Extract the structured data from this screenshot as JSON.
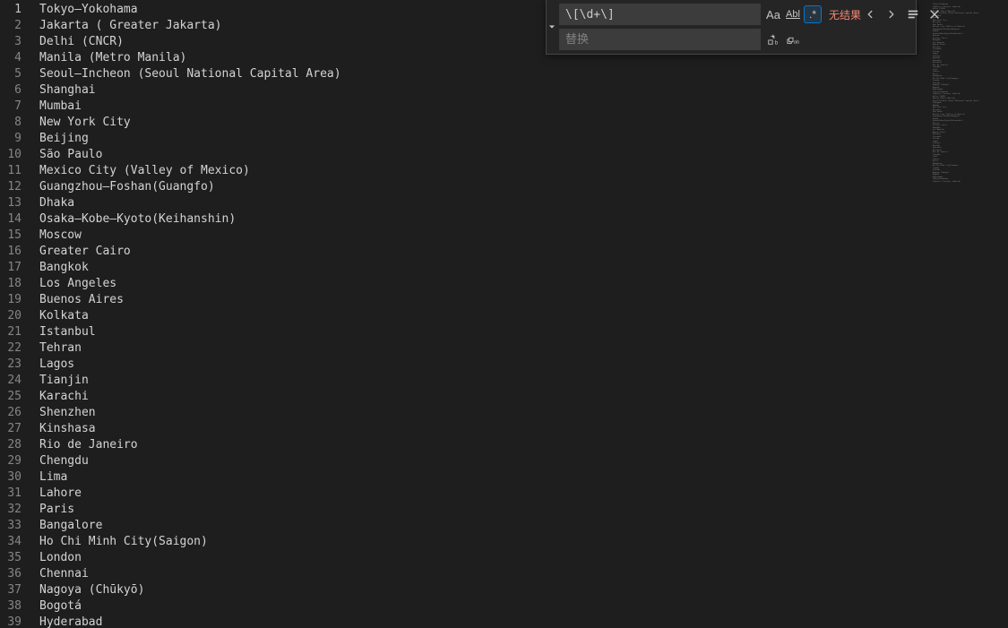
{
  "lines": [
    "Tokyo—Yokohama",
    "Jakarta ( Greater Jakarta)",
    "Delhi (CNCR)",
    "Manila (Metro Manila)",
    "Seoul—Incheon (Seoul National Capital Area)",
    "Shanghai",
    "Mumbai",
    "New York City",
    "Beijing",
    "São Paulo",
    "Mexico City (Valley of Mexico)",
    "Guangzhou—Foshan(Guangfo)",
    "Dhaka",
    "Osaka—Kobe—Kyoto(Keihanshin)",
    "Moscow",
    "Greater Cairo",
    "Bangkok",
    "Los Angeles",
    "Buenos Aires",
    "Kolkata",
    "Istanbul",
    "Tehran",
    "Lagos",
    "Tianjin",
    "Karachi",
    "Shenzhen",
    "Kinshasa",
    "Rio de Janeiro",
    "Chengdu",
    "Lima",
    "Lahore",
    "Paris",
    "Bangalore",
    "Ho Chi Minh City(Saigon)",
    "London",
    "Chennai",
    "Nagoya (Chūkyō)",
    "Bogotá",
    "Hyderabad"
  ],
  "activeLine": 1,
  "findReplace": {
    "searchValue": "\\[\\d+\\]",
    "replacePlaceholder": "替换",
    "matchResult": "无结果",
    "caseSensitive": "Aa",
    "wholeWord": "Abl",
    "regex": ".*"
  }
}
